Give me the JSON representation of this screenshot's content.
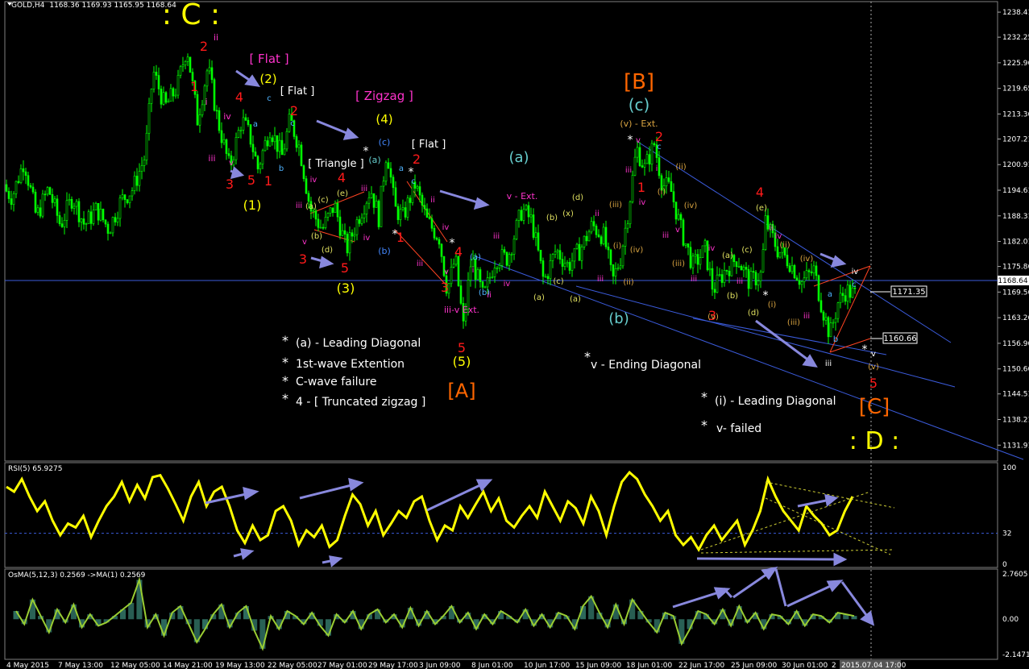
{
  "window": {
    "symbol_label": "GOLD,H4",
    "ohlc": "1168.36 1169.93 1165.95 1168.64"
  },
  "colors": {
    "background": "#000000",
    "candle": "#00ff00",
    "grid": "#3a3a3a",
    "hline": "#3b5bdb",
    "trend_line": "#3b5bdb",
    "arrow": "#8888dd",
    "rsi_line": "#ffff00",
    "osma_line": "#9acd32",
    "osma_hist": "#2e6b5e",
    "price_box_bg": "#000000",
    "red": "#ff1a1a",
    "yellow": "#ffff00",
    "cyan": "#66cccc",
    "magenta": "#ff33cc",
    "orange": "#ff6600",
    "tan": "#d9a441",
    "white": "#ffffff",
    "blue_label": "#4488ff"
  },
  "chart_data": [
    {
      "type": "line",
      "panel": "price",
      "title": "GOLD,H4",
      "ylim": [
        1128,
        1241
      ],
      "y_ticks": [
        "1238.41",
        "1232.25",
        "1225.96",
        "1219.65",
        "1213.36",
        "1207.21",
        "1200.91",
        "1194.61",
        "1188.31",
        "1182.01",
        "1175.86",
        "1169.56",
        "1163.26",
        "1156.96",
        "1150.66",
        "1144.51",
        "1138.21",
        "1131.91"
      ],
      "x_ticks": [
        "4 May 2015",
        "7 May 13:00",
        "12 May 05:00",
        "14 May 21:00",
        "19 May 13:00",
        "22 May 05:00",
        "27 May 01:00",
        "29 May 17:00",
        "3 Jun 09:00",
        "8 Jun 01:00",
        "10 Jun 17:00",
        "15 Jun 09:00",
        "18 Jun 01:00",
        "22 Jun 17:00",
        "25 Jun 09:00",
        "30 Jun 01:00",
        "2",
        "2015.07.04 17:00"
      ],
      "price_waypoints": [
        [
          0,
          1196
        ],
        [
          15,
          1193
        ],
        [
          30,
          1202
        ],
        [
          45,
          1188
        ],
        [
          60,
          1195
        ],
        [
          75,
          1186
        ],
        [
          90,
          1193
        ],
        [
          105,
          1186
        ],
        [
          120,
          1190
        ],
        [
          135,
          1185
        ],
        [
          150,
          1192
        ],
        [
          165,
          1195
        ],
        [
          180,
          1203
        ],
        [
          190,
          1224
        ],
        [
          205,
          1215
        ],
        [
          220,
          1220
        ],
        [
          232,
          1230
        ],
        [
          245,
          1212
        ],
        [
          258,
          1225
        ],
        [
          270,
          1212
        ],
        [
          285,
          1200
        ],
        [
          300,
          1212
        ],
        [
          310,
          1208
        ],
        [
          320,
          1200
        ],
        [
          335,
          1210
        ],
        [
          350,
          1203
        ],
        [
          360,
          1212
        ],
        [
          372,
          1205
        ],
        [
          385,
          1190
        ],
        [
          400,
          1185
        ],
        [
          415,
          1191
        ],
        [
          430,
          1180
        ],
        [
          445,
          1188
        ],
        [
          460,
          1195
        ],
        [
          470,
          1188
        ],
        [
          480,
          1205
        ],
        [
          490,
          1190
        ],
        [
          500,
          1188
        ],
        [
          515,
          1196
        ],
        [
          530,
          1187
        ],
        [
          545,
          1183
        ],
        [
          555,
          1170
        ],
        [
          565,
          1178
        ],
        [
          575,
          1161
        ],
        [
          585,
          1178
        ],
        [
          600,
          1168
        ],
        [
          615,
          1178
        ],
        [
          630,
          1178
        ],
        [
          648,
          1190
        ],
        [
          660,
          1187
        ],
        [
          675,
          1172
        ],
        [
          690,
          1180
        ],
        [
          705,
          1176
        ],
        [
          720,
          1180
        ],
        [
          735,
          1186
        ],
        [
          750,
          1183
        ],
        [
          760,
          1172
        ],
        [
          770,
          1178
        ],
        [
          780,
          1190
        ],
        [
          790,
          1205
        ],
        [
          800,
          1200
        ],
        [
          812,
          1206
        ],
        [
          822,
          1196
        ],
        [
          832,
          1195
        ],
        [
          845,
          1185
        ],
        [
          860,
          1176
        ],
        [
          875,
          1180
        ],
        [
          885,
          1170
        ],
        [
          900,
          1175
        ],
        [
          915,
          1178
        ],
        [
          930,
          1172
        ],
        [
          945,
          1174
        ],
        [
          950,
          1187
        ],
        [
          965,
          1180
        ],
        [
          980,
          1177
        ],
        [
          995,
          1172
        ],
        [
          1010,
          1175
        ],
        [
          1020,
          1166
        ],
        [
          1030,
          1159
        ],
        [
          1040,
          1167
        ],
        [
          1050,
          1170
        ],
        [
          1060,
          1169
        ]
      ],
      "current_price": "1168.64",
      "price_boxes": [
        "1171.35",
        "1160.66"
      ],
      "annotations": [
        {
          "text": ": C :",
          "color": "yellow",
          "size": "xl"
        },
        {
          "text": "2",
          "color": "red"
        },
        {
          "text": "1",
          "color": "red"
        },
        {
          "text": "ii",
          "color": "magenta"
        },
        {
          "text": "i",
          "color": "magenta"
        },
        {
          "text": "[ Flat ]",
          "color": "magenta"
        },
        {
          "text": "(2)",
          "color": "yellow"
        },
        {
          "text": "[ Flat ]",
          "color": "white"
        },
        {
          "text": "4",
          "color": "red"
        },
        {
          "text": "2",
          "color": "red"
        },
        {
          "text": "iii",
          "color": "magenta"
        },
        {
          "text": "iv",
          "color": "magenta"
        },
        {
          "text": "3",
          "color": "red"
        },
        {
          "text": "5",
          "color": "red"
        },
        {
          "text": "1",
          "color": "red"
        },
        {
          "text": "(1)",
          "color": "yellow"
        },
        {
          "text": "[ Zigzag ]",
          "color": "magenta"
        },
        {
          "text": "(4)",
          "color": "yellow"
        },
        {
          "text": "[ Flat ]",
          "color": "white"
        },
        {
          "text": "[ Triangle ]",
          "color": "white"
        },
        {
          "text": "4",
          "color": "red"
        },
        {
          "text": "2",
          "color": "red"
        },
        {
          "text": "(a)",
          "color": "cyan"
        },
        {
          "text": "(c)",
          "color": "blue_label"
        },
        {
          "text": "(b)",
          "color": "blue_label"
        },
        {
          "text": "3",
          "color": "red"
        },
        {
          "text": "5",
          "color": "red"
        },
        {
          "text": "(3)",
          "color": "yellow"
        },
        {
          "text": "1",
          "color": "red"
        },
        {
          "text": "4",
          "color": "red"
        },
        {
          "text": "3",
          "color": "red"
        },
        {
          "text": "5",
          "color": "red"
        },
        {
          "text": "(5)",
          "color": "yellow"
        },
        {
          "text": "[A]",
          "color": "orange"
        },
        {
          "text": "iii-v Ext.",
          "color": "magenta"
        },
        {
          "text": "(a)",
          "color": "cyan"
        },
        {
          "text": "v - Ext.",
          "color": "magenta"
        },
        {
          "text": "(b)",
          "color": "cyan"
        },
        {
          "text": "[B]",
          "color": "orange"
        },
        {
          "text": "(c)",
          "color": "cyan"
        },
        {
          "text": "(v) - Ext.",
          "color": "tan"
        },
        {
          "text": "2",
          "color": "red"
        },
        {
          "text": "1",
          "color": "red"
        },
        {
          "text": "4",
          "color": "red"
        },
        {
          "text": "3",
          "color": "red"
        },
        {
          "text": "5",
          "color": "red"
        },
        {
          "text": "[C]",
          "color": "orange"
        },
        {
          "text": ": D :",
          "color": "yellow"
        }
      ],
      "notes": [
        "(a) - Leading Diagonal",
        "1st-wave Extention",
        "C-wave failure",
        "4 - [ Truncated zigzag ]",
        "v - Ending Diagonal",
        "(i) - Leading Diagonal",
        "v- failed"
      ]
    },
    {
      "type": "line",
      "panel": "rsi",
      "title": "RSI(5) 65.9275",
      "ylim": [
        0,
        100
      ],
      "y_ticks": [
        "100",
        "32",
        "0"
      ],
      "levels": [
        32
      ],
      "series": [
        {
          "name": "RSI(5)",
          "values": [
            80,
            75,
            88,
            70,
            55,
            65,
            45,
            30,
            42,
            38,
            50,
            28,
            45,
            60,
            70,
            85,
            65,
            82,
            68,
            90,
            92,
            78,
            62,
            45,
            70,
            85,
            60,
            75,
            80,
            60,
            35,
            22,
            40,
            25,
            30,
            55,
            60,
            45,
            20,
            35,
            28,
            40,
            18,
            25,
            50,
            72,
            62,
            40,
            55,
            30,
            42,
            55,
            48,
            65,
            70,
            45,
            25,
            40,
            35,
            60,
            48,
            62,
            75,
            55,
            68,
            45,
            38,
            50,
            60,
            48,
            75,
            60,
            45,
            65,
            58,
            42,
            70,
            55,
            30,
            60,
            85,
            95,
            88,
            72,
            60,
            45,
            55,
            30,
            20,
            28,
            15,
            30,
            40,
            25,
            35,
            45,
            20,
            35,
            55,
            88,
            70,
            55,
            45,
            35,
            60,
            50,
            42,
            30,
            35,
            55,
            70
          ]
        }
      ]
    },
    {
      "type": "bar",
      "panel": "osma",
      "title": "OsMA(5,12,3) 0.2569 ->MA(1) 0.2569",
      "ylim": [
        -2.1471,
        2.7605
      ],
      "y_ticks": [
        "2.7605",
        "0.00",
        "-2.1471"
      ],
      "series": [
        {
          "name": "OsMA",
          "values": [
            0.5,
            -0.3,
            1.2,
            0.2,
            -0.8,
            0.6,
            -0.2,
            0.9,
            -0.5,
            0.3,
            -0.4,
            -0.2,
            0.2,
            0.6,
            1.0,
            2.4,
            -0.5,
            0.3,
            -1.0,
            0.4,
            0.8,
            -0.3,
            -1.4,
            -0.6,
            0.3,
            0.9,
            -0.5,
            0.4,
            0.8,
            -0.7,
            -1.8,
            0.2,
            -0.6,
            0.5,
            0.2,
            -0.3,
            0.4,
            -0.4,
            -1.0,
            0.3,
            -0.2,
            0.5,
            -0.6,
            0.3,
            0.6,
            -0.2,
            0.3,
            -0.5,
            0.7,
            -0.4,
            0.5,
            -0.3,
            0.2,
            0.8,
            -0.2,
            0.4,
            -0.6,
            0.3,
            -0.3,
            0.5,
            0.2,
            -0.2,
            0.6,
            -0.4,
            0.3,
            -0.5,
            0.4,
            0.2,
            -0.6,
            0.8,
            1.4,
            0.4,
            -0.5,
            0.9,
            -0.3,
            1.2,
            0.5,
            -0.2,
            -0.8,
            0.4,
            0.2,
            -1.5,
            -0.6,
            0.5,
            0.3,
            -0.3,
            0.6,
            -0.4,
            0.8,
            -0.2,
            0.4,
            -0.6,
            0.3,
            0.2,
            -0.3,
            0.5,
            -0.4,
            0.3,
            0.2,
            -0.2,
            0.4,
            0.3,
            0.2
          ]
        }
      ]
    }
  ]
}
